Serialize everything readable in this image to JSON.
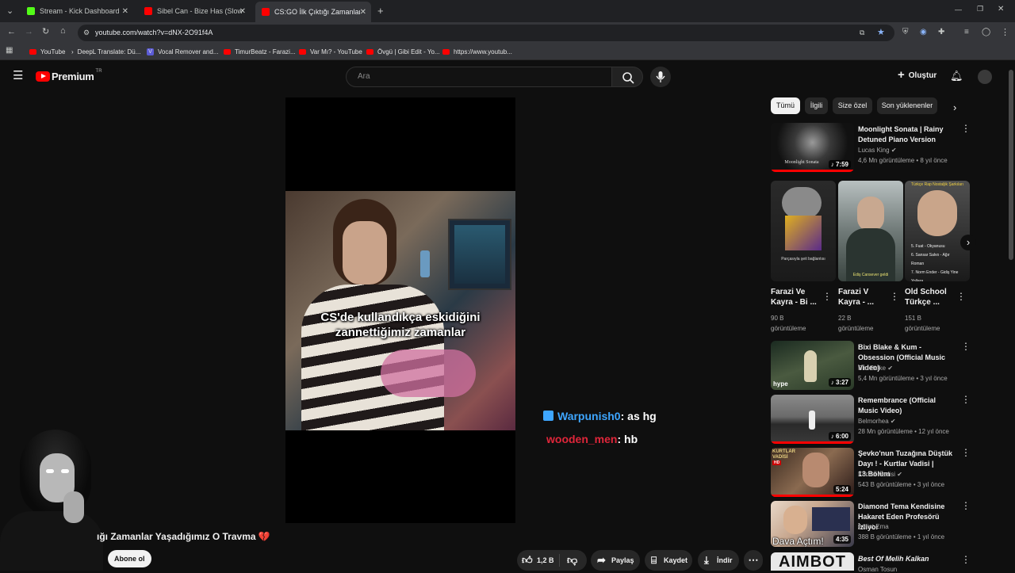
{
  "browser": {
    "tabs": [
      {
        "title": "Stream - Kick Dashboard",
        "favicon_color": "#53fc18"
      },
      {
        "title": "Sibel Can - Bize Has (Slowed +",
        "favicon_color": "#ff0000"
      },
      {
        "title": "CS:GO İlk Çıktığı Zamanlar Yaşa",
        "favicon_color": "#ff0000"
      }
    ],
    "new_tab": "+",
    "url": "youtube.com/watch?v=dNX-2O91f4A",
    "bookmarks": [
      "YouTube",
      "DeepL Translate: Dü...",
      "Vocal Remover and...",
      "TimurBeatz - Farazi...",
      "Var Mı? - YouTube",
      "Övgü | Gibi Edit - Yo...",
      "https://www.youtub..."
    ]
  },
  "youtube": {
    "logo_text": "Premium",
    "logo_sup": "TR",
    "search_placeholder": "Ara",
    "create_label": "Oluştur",
    "chips": [
      "Tümü",
      "İlgili",
      "Size özel",
      "Son yüklenenler"
    ],
    "video": {
      "overlay_line1": "CS'de kullandıkça eskidiğini",
      "overlay_line2": "zannettiğimiz zamanlar",
      "title_fragment": "ığı Zamanlar Yaşadığımız O Travma 💔",
      "subscribe_label": "Abone ol",
      "likes": "1,2 B",
      "share_label": "Paylaş",
      "save_label": "Kaydet",
      "download_label": "İndir"
    },
    "chat": [
      {
        "user": "Warpunish0",
        "message": ": as hg",
        "color": "#3ea6ff"
      },
      {
        "user": "wooden_men",
        "message": ": hb",
        "color": "#e0263a"
      }
    ],
    "recommendations": [
      {
        "title": "Moonlight Sonata | Rainy Detuned Piano Version",
        "channel": "Lucas King",
        "meta": "4,6 Mn görüntüleme • 8 yıl önce",
        "duration": "7:59",
        "thumb_text": "Moonlight Sonata"
      },
      {
        "title": "Bixi Blake & Kum - Obsession (Official Music Video)",
        "channel": "Bixi Blake",
        "meta": "5,4 Mn görüntüleme • 3 yıl önce",
        "duration": "3:27",
        "thumb_text": "hype"
      },
      {
        "title": "Remembrance (Official Music Video)",
        "channel": "Belmorhea",
        "meta": "28 Mn görüntüleme • 12 yıl önce",
        "duration": "6:00",
        "thumb_text": ""
      },
      {
        "title": "Şevko'nun Tuzağına Düştük Dayı ! - Kurtlar Vadisi | 13.Bölüm",
        "channel": "Kurtlar Vadisi",
        "meta": "543 B görüntüleme • 3 yıl önce",
        "duration": "5:24",
        "thumb_text": "KURTLAR VADİSİ"
      },
      {
        "title": "Diamond Tema Kendisine Hakaret Eden Profesörü İzliyor",
        "channel": "Ateist Ema",
        "meta": "388 B görüntüleme • 1 yıl önce",
        "duration": "4:35",
        "thumb_text": "Dava Açtım!"
      },
      {
        "title": "Best Of Melih Kalkan",
        "channel": "Osman Tosun",
        "meta": "",
        "duration": "",
        "thumb_text": "AIMBOT"
      }
    ],
    "shorts": [
      {
        "title": "Farazi Ve Kayra - Bi ...",
        "views": "90 B görüntüleme",
        "overlay": "Parçasıyla şeit bağlantısı"
      },
      {
        "title": "Farazi V Kayra - ...",
        "views": "22 B görüntüleme",
        "overlay": "Ediş Cansever geldi"
      },
      {
        "title": "Old School Türkçe ...",
        "views": "151 B görüntüleme",
        "overlay": "Türkçe Rap Nostaljik Şarkıları"
      }
    ]
  }
}
